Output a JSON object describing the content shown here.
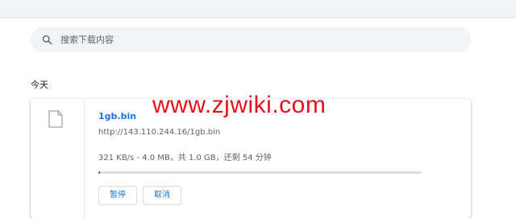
{
  "search": {
    "placeholder": "搜索下载内容"
  },
  "section": {
    "title": "今天"
  },
  "download": {
    "file_name": "1gb.bin",
    "url": "http://143.110.244.16/1gb.bin",
    "status": "321 KB/s - 4.0 MB，共 1.0 GB，还剩 54 分钟",
    "progress_fraction": 0.004,
    "pause_label": "暂停",
    "cancel_label": "取消"
  },
  "watermark": {
    "text": "www.zjwiki.com"
  },
  "colors": {
    "accent": "#1a73e8",
    "watermark": "#e8101a"
  }
}
